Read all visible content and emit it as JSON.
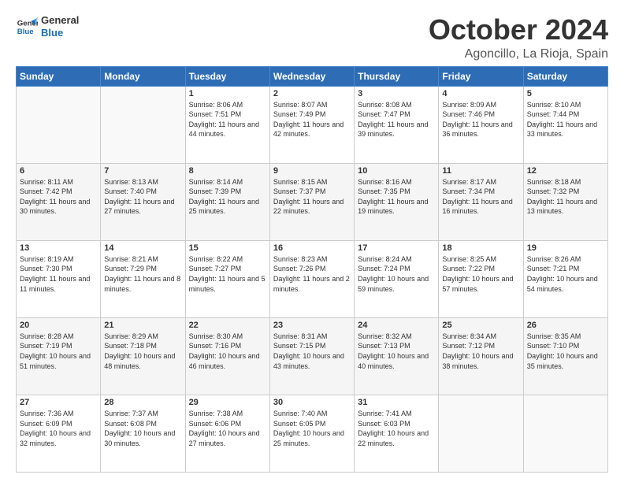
{
  "header": {
    "logo_line1": "General",
    "logo_line2": "Blue",
    "month": "October 2024",
    "location": "Agoncillo, La Rioja, Spain"
  },
  "days_of_week": [
    "Sunday",
    "Monday",
    "Tuesday",
    "Wednesday",
    "Thursday",
    "Friday",
    "Saturday"
  ],
  "weeks": [
    [
      {
        "day": "",
        "info": ""
      },
      {
        "day": "",
        "info": ""
      },
      {
        "day": "1",
        "info": "Sunrise: 8:06 AM\nSunset: 7:51 PM\nDaylight: 11 hours and 44 minutes."
      },
      {
        "day": "2",
        "info": "Sunrise: 8:07 AM\nSunset: 7:49 PM\nDaylight: 11 hours and 42 minutes."
      },
      {
        "day": "3",
        "info": "Sunrise: 8:08 AM\nSunset: 7:47 PM\nDaylight: 11 hours and 39 minutes."
      },
      {
        "day": "4",
        "info": "Sunrise: 8:09 AM\nSunset: 7:46 PM\nDaylight: 11 hours and 36 minutes."
      },
      {
        "day": "5",
        "info": "Sunrise: 8:10 AM\nSunset: 7:44 PM\nDaylight: 11 hours and 33 minutes."
      }
    ],
    [
      {
        "day": "6",
        "info": "Sunrise: 8:11 AM\nSunset: 7:42 PM\nDaylight: 11 hours and 30 minutes."
      },
      {
        "day": "7",
        "info": "Sunrise: 8:13 AM\nSunset: 7:40 PM\nDaylight: 11 hours and 27 minutes."
      },
      {
        "day": "8",
        "info": "Sunrise: 8:14 AM\nSunset: 7:39 PM\nDaylight: 11 hours and 25 minutes."
      },
      {
        "day": "9",
        "info": "Sunrise: 8:15 AM\nSunset: 7:37 PM\nDaylight: 11 hours and 22 minutes."
      },
      {
        "day": "10",
        "info": "Sunrise: 8:16 AM\nSunset: 7:35 PM\nDaylight: 11 hours and 19 minutes."
      },
      {
        "day": "11",
        "info": "Sunrise: 8:17 AM\nSunset: 7:34 PM\nDaylight: 11 hours and 16 minutes."
      },
      {
        "day": "12",
        "info": "Sunrise: 8:18 AM\nSunset: 7:32 PM\nDaylight: 11 hours and 13 minutes."
      }
    ],
    [
      {
        "day": "13",
        "info": "Sunrise: 8:19 AM\nSunset: 7:30 PM\nDaylight: 11 hours and 11 minutes."
      },
      {
        "day": "14",
        "info": "Sunrise: 8:21 AM\nSunset: 7:29 PM\nDaylight: 11 hours and 8 minutes."
      },
      {
        "day": "15",
        "info": "Sunrise: 8:22 AM\nSunset: 7:27 PM\nDaylight: 11 hours and 5 minutes."
      },
      {
        "day": "16",
        "info": "Sunrise: 8:23 AM\nSunset: 7:26 PM\nDaylight: 11 hours and 2 minutes."
      },
      {
        "day": "17",
        "info": "Sunrise: 8:24 AM\nSunset: 7:24 PM\nDaylight: 10 hours and 59 minutes."
      },
      {
        "day": "18",
        "info": "Sunrise: 8:25 AM\nSunset: 7:22 PM\nDaylight: 10 hours and 57 minutes."
      },
      {
        "day": "19",
        "info": "Sunrise: 8:26 AM\nSunset: 7:21 PM\nDaylight: 10 hours and 54 minutes."
      }
    ],
    [
      {
        "day": "20",
        "info": "Sunrise: 8:28 AM\nSunset: 7:19 PM\nDaylight: 10 hours and 51 minutes."
      },
      {
        "day": "21",
        "info": "Sunrise: 8:29 AM\nSunset: 7:18 PM\nDaylight: 10 hours and 48 minutes."
      },
      {
        "day": "22",
        "info": "Sunrise: 8:30 AM\nSunset: 7:16 PM\nDaylight: 10 hours and 46 minutes."
      },
      {
        "day": "23",
        "info": "Sunrise: 8:31 AM\nSunset: 7:15 PM\nDaylight: 10 hours and 43 minutes."
      },
      {
        "day": "24",
        "info": "Sunrise: 8:32 AM\nSunset: 7:13 PM\nDaylight: 10 hours and 40 minutes."
      },
      {
        "day": "25",
        "info": "Sunrise: 8:34 AM\nSunset: 7:12 PM\nDaylight: 10 hours and 38 minutes."
      },
      {
        "day": "26",
        "info": "Sunrise: 8:35 AM\nSunset: 7:10 PM\nDaylight: 10 hours and 35 minutes."
      }
    ],
    [
      {
        "day": "27",
        "info": "Sunrise: 7:36 AM\nSunset: 6:09 PM\nDaylight: 10 hours and 32 minutes."
      },
      {
        "day": "28",
        "info": "Sunrise: 7:37 AM\nSunset: 6:08 PM\nDaylight: 10 hours and 30 minutes."
      },
      {
        "day": "29",
        "info": "Sunrise: 7:38 AM\nSunset: 6:06 PM\nDaylight: 10 hours and 27 minutes."
      },
      {
        "day": "30",
        "info": "Sunrise: 7:40 AM\nSunset: 6:05 PM\nDaylight: 10 hours and 25 minutes."
      },
      {
        "day": "31",
        "info": "Sunrise: 7:41 AM\nSunset: 6:03 PM\nDaylight: 10 hours and 22 minutes."
      },
      {
        "day": "",
        "info": ""
      },
      {
        "day": "",
        "info": ""
      }
    ]
  ]
}
